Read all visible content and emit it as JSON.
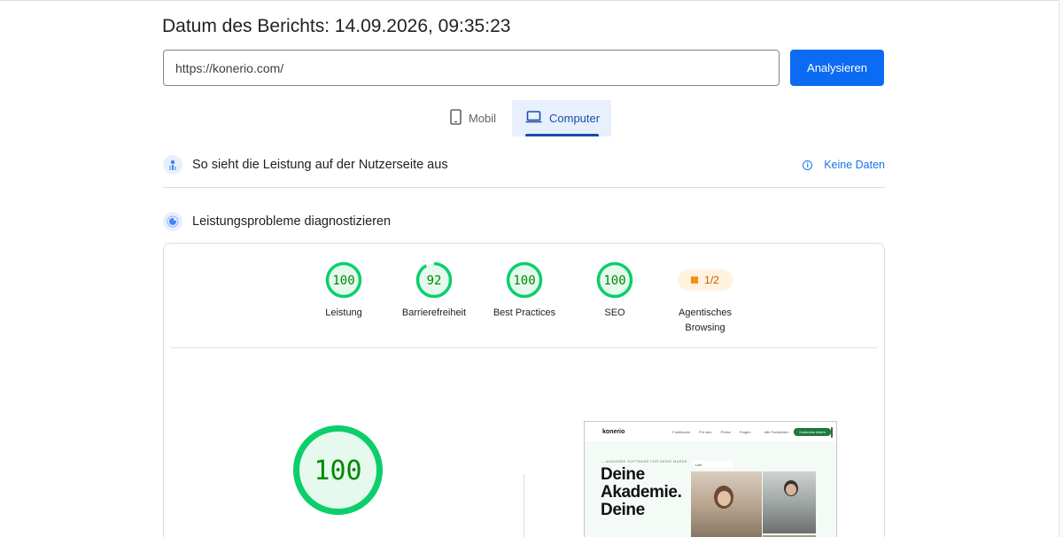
{
  "report": {
    "date_label": "Datum des Berichts: 14.09.2026, 09:35:23"
  },
  "search": {
    "url_value": "https://konerio.com/",
    "analyze_label": "Analysieren"
  },
  "device_tabs": [
    {
      "label": "Mobil",
      "icon": "phone-icon",
      "active": false
    },
    {
      "label": "Computer",
      "icon": "laptop-icon",
      "active": true
    }
  ],
  "field_data": {
    "title": "So sieht die Leistung auf der Nutzerseite aus",
    "no_data_label": "Keine Daten"
  },
  "diagnostics": {
    "title": "Leistungsprobleme diagnostizieren"
  },
  "scores": [
    {
      "label": "Leistung",
      "value": 100
    },
    {
      "label": "Barrierefreiheit",
      "value": 92
    },
    {
      "label": "Best Practices",
      "value": 100
    },
    {
      "label": "SEO",
      "value": 100
    }
  ],
  "agentic": {
    "value": "1/2",
    "label_line1": "Agentisches",
    "label_line2": "Browsing"
  },
  "big_score": {
    "value": 100
  },
  "preview": {
    "logo": "konerio",
    "nav_links": [
      "Funktionen",
      "Für wen",
      "Preise",
      "Fragen"
    ],
    "login_label": "Alle Funktionen",
    "cta_label": "Kostenlos testen",
    "eyebrow": "— AKADEMIE SOFTWARE FÜR DEINE MARKE",
    "badge": "Live",
    "headline": "Deine Akademie. Deine"
  },
  "colors": {
    "pass_green": "#0cce6b",
    "pass_bg": "#e6f9ee",
    "pass_text": "#008800",
    "accent_blue": "#1a73e8",
    "warn_orange": "#fa8c16"
  }
}
